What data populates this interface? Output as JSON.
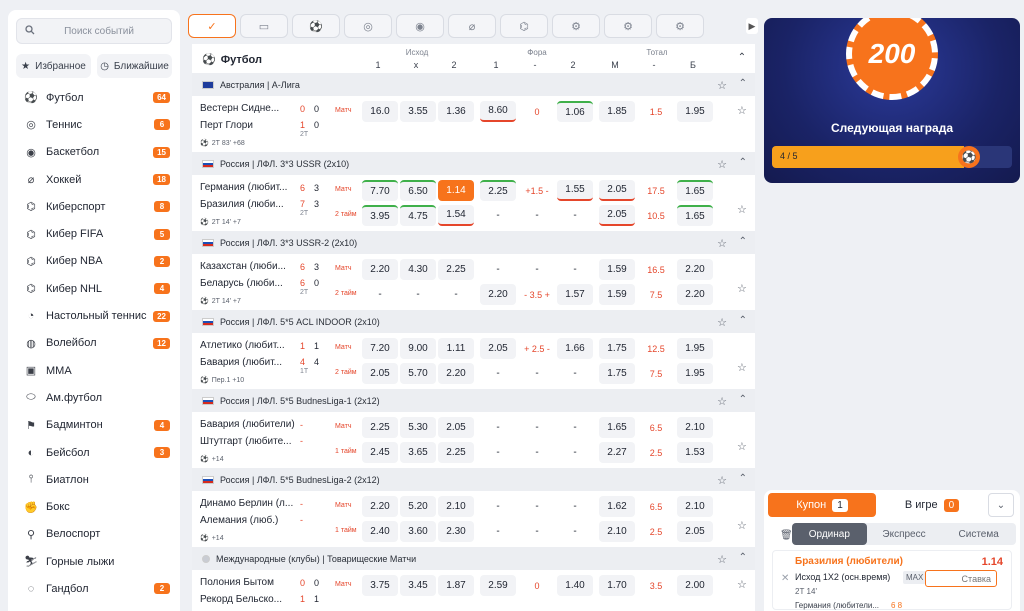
{
  "sidebar": {
    "search_placeholder": "Поиск событий",
    "favorites": "Избранное",
    "nearest": "Ближайшие",
    "items": [
      {
        "name": "Футбол",
        "count": "64",
        "icon": "soccer-icon"
      },
      {
        "name": "Теннис",
        "count": "6",
        "icon": "tennis-icon"
      },
      {
        "name": "Баскетбол",
        "count": "15",
        "icon": "basketball-icon"
      },
      {
        "name": "Хоккей",
        "count": "18",
        "icon": "hockey-icon"
      },
      {
        "name": "Киберспорт",
        "count": "8",
        "icon": "esports-icon"
      },
      {
        "name": "Кибер FIFA",
        "count": "5",
        "icon": "cyber-fifa-icon"
      },
      {
        "name": "Кибер NBA",
        "count": "2",
        "icon": "cyber-nba-icon"
      },
      {
        "name": "Кибер NHL",
        "count": "4",
        "icon": "cyber-nhl-icon"
      },
      {
        "name": "Настольный теннис",
        "count": "22",
        "icon": "table-tennis-icon"
      },
      {
        "name": "Волейбол",
        "count": "12",
        "icon": "volleyball-icon"
      },
      {
        "name": "MMA",
        "count": "",
        "icon": "mma-icon"
      },
      {
        "name": "Ам.футбол",
        "count": "",
        "icon": "american-football-icon"
      },
      {
        "name": "Бадминтон",
        "count": "4",
        "icon": "badminton-icon"
      },
      {
        "name": "Бейсбол",
        "count": "3",
        "icon": "baseball-icon"
      },
      {
        "name": "Биатлон",
        "count": "",
        "icon": "biathlon-icon"
      },
      {
        "name": "Бокс",
        "count": "",
        "icon": "boxing-icon"
      },
      {
        "name": "Велоспорт",
        "count": "",
        "icon": "cycling-icon"
      },
      {
        "name": "Горные лыжи",
        "count": "",
        "icon": "skiing-icon"
      },
      {
        "name": "Гандбол",
        "count": "2",
        "icon": "handball-icon"
      }
    ]
  },
  "header": {
    "sport": "Футбол",
    "groups": {
      "outcome": "Исход",
      "fora": "Фора",
      "total": "Тотал"
    },
    "cols": [
      "1",
      "х",
      "2",
      "1",
      "-",
      "2",
      "М",
      "-",
      "Б"
    ]
  },
  "leagues": [
    {
      "name": "Австралия | А-Лига",
      "flag": "au",
      "matches": [
        {
          "team1": "Вестерн Сидне...",
          "team2": "Перт Глори",
          "s1a": "0",
          "s1b": "0",
          "s2a": "1",
          "s2b": "0",
          "per": "2Т",
          "meta": "2Т 83' +68",
          "rows": [
            {
              "label": "Матч",
              "odds": [
                "16.0",
                "3.55",
                "1.36",
                "8.60",
                "0",
                "1.06",
                "1.85",
                "1.5",
                "1.95"
              ],
              "fx": [
                "",
                "",
                "",
                "dn",
                "han",
                "up",
                "",
                "red",
                ""
              ]
            }
          ]
        }
      ]
    },
    {
      "name": "Россия | ЛФЛ. 3*3 USSR (2x10)",
      "flag": "ru",
      "matches": [
        {
          "team1": "Германия (любит...",
          "team2": "Бразилия (люби...",
          "s1a": "6",
          "s1b": "3",
          "s2a": "7",
          "s2b": "3",
          "per": "2Т",
          "meta": "2Т 14' +7",
          "rows": [
            {
              "label": "Матч",
              "odds": [
                "7.70",
                "6.50",
                "1.14",
                "2.25",
                "+1.5 -",
                "1.55",
                "2.05",
                "17.5",
                "1.65"
              ],
              "fx": [
                "up",
                "up",
                "sel",
                "up",
                "han",
                "dn",
                "dn",
                "red",
                "up"
              ]
            },
            {
              "label": "2 тайм",
              "odds": [
                "3.95",
                "4.75",
                "1.54",
                "-",
                "-",
                "-",
                "2.05",
                "10.5",
                "1.65"
              ],
              "fx": [
                "up",
                "up",
                "dn",
                "",
                "",
                "",
                "dn",
                "red",
                "up"
              ]
            }
          ]
        }
      ]
    },
    {
      "name": "Россия | ЛФЛ. 3*3 USSR-2 (2x10)",
      "flag": "ru",
      "matches": [
        {
          "team1": "Казахстан (люби...",
          "team2": "Беларусь (люби...",
          "s1a": "6",
          "s1b": "3",
          "s2a": "6",
          "s2b": "0",
          "per": "2Т",
          "meta": "2Т 14' +7",
          "rows": [
            {
              "label": "Матч",
              "odds": [
                "2.20",
                "4.30",
                "2.25",
                "-",
                "-",
                "-",
                "1.59",
                "16.5",
                "2.20"
              ],
              "fx": [
                "",
                "",
                "",
                "",
                "",
                "",
                "",
                "red",
                ""
              ]
            },
            {
              "label": "2 тайм",
              "odds": [
                "-",
                "-",
                "-",
                "2.20",
                "- 3.5 +",
                "1.57",
                "1.59",
                "7.5",
                "2.20"
              ],
              "fx": [
                "",
                "",
                "",
                "",
                "han",
                "",
                "",
                "red",
                ""
              ]
            }
          ]
        }
      ]
    },
    {
      "name": "Россия | ЛФЛ. 5*5 ACL INDOOR (2x10)",
      "flag": "ru",
      "matches": [
        {
          "team1": "Атлетико (любит...",
          "team2": "Бавария (любит...",
          "s1a": "1",
          "s1b": "1",
          "s2a": "4",
          "s2b": "4",
          "per": "1Т",
          "meta": "Пер.1 +10",
          "rows": [
            {
              "label": "Матч",
              "odds": [
                "7.20",
                "9.00",
                "1.11",
                "2.05",
                "+ 2.5 -",
                "1.66",
                "1.75",
                "12.5",
                "1.95"
              ],
              "fx": [
                "",
                "",
                "",
                "",
                "han",
                "",
                "",
                "red",
                ""
              ]
            },
            {
              "label": "2 тайм",
              "odds": [
                "2.05",
                "5.70",
                "2.20",
                "-",
                "-",
                "-",
                "1.75",
                "7.5",
                "1.95"
              ],
              "fx": [
                "",
                "",
                "",
                "",
                "",
                "",
                "",
                "red",
                ""
              ]
            }
          ]
        }
      ]
    },
    {
      "name": "Россия | ЛФЛ. 5*5 BudnesLiga-1 (2x12)",
      "flag": "ru",
      "matches": [
        {
          "team1": "Бавария (любители)",
          "team2": "Штутгарт (любите...",
          "s1a": "-",
          "s1b": "",
          "s2a": "-",
          "s2b": "",
          "per": "",
          "meta": "+14",
          "rows": [
            {
              "label": "Матч",
              "odds": [
                "2.25",
                "5.30",
                "2.05",
                "-",
                "-",
                "-",
                "1.65",
                "6.5",
                "2.10"
              ],
              "fx": [
                "",
                "",
                "",
                "",
                "",
                "",
                "",
                "red",
                ""
              ]
            },
            {
              "label": "1 тайм",
              "odds": [
                "2.45",
                "3.65",
                "2.25",
                "-",
                "-",
                "-",
                "2.27",
                "2.5",
                "1.53"
              ],
              "fx": [
                "",
                "",
                "",
                "",
                "",
                "",
                "",
                "red",
                ""
              ]
            }
          ]
        }
      ]
    },
    {
      "name": "Россия | ЛФЛ. 5*5 BudnesLiga-2 (2x12)",
      "flag": "ru",
      "matches": [
        {
          "team1": "Динамо Берлин (л...",
          "team2": "Алемания (люб.)",
          "s1a": "-",
          "s1b": "",
          "s2a": "-",
          "s2b": "",
          "per": "",
          "meta": "+14",
          "rows": [
            {
              "label": "Матч",
              "odds": [
                "2.20",
                "5.20",
                "2.10",
                "-",
                "-",
                "-",
                "1.62",
                "6.5",
                "2.10"
              ],
              "fx": [
                "",
                "",
                "",
                "",
                "",
                "",
                "",
                "red",
                ""
              ]
            },
            {
              "label": "1 тайм",
              "odds": [
                "2.40",
                "3.60",
                "2.30",
                "-",
                "-",
                "-",
                "2.10",
                "2.5",
                "2.05"
              ],
              "fx": [
                "",
                "",
                "",
                "",
                "",
                "",
                "",
                "red",
                ""
              ]
            }
          ]
        }
      ]
    },
    {
      "name": "Международные (клубы) | Товарищеские Матчи",
      "flag": "int",
      "matches": [
        {
          "team1": "Полония Бытом",
          "team2": "Рекорд Бельско...",
          "s1a": "0",
          "s1b": "0",
          "s2a": "1",
          "s2b": "1",
          "per": "",
          "meta": "",
          "rows": [
            {
              "label": "Матч",
              "odds": [
                "3.75",
                "3.45",
                "1.87",
                "2.59",
                "0",
                "1.40",
                "1.70",
                "3.5",
                "2.00"
              ],
              "fx": [
                "",
                "",
                "",
                "",
                "han",
                "",
                "",
                "red",
                ""
              ]
            }
          ]
        }
      ]
    }
  ],
  "promo": {
    "amount": "200",
    "title": "Следующая награда",
    "progress_text": "4 / 5",
    "progress": 0.8
  },
  "coupon": {
    "tab": "Купон",
    "tab_count": "1",
    "live": "В игре",
    "live_count": "0",
    "types": [
      "Ординар",
      "Экспресс",
      "Система"
    ],
    "slip": {
      "team": "Бразилия (любители)",
      "odd": "1.14",
      "outcome": "Исход 1X2 (осн.время)",
      "period": "2Т 14'",
      "max": "MAX",
      "stake_placeholder": "Ставка",
      "event": "Германия (любители...",
      "event_odd": "6 8"
    }
  }
}
